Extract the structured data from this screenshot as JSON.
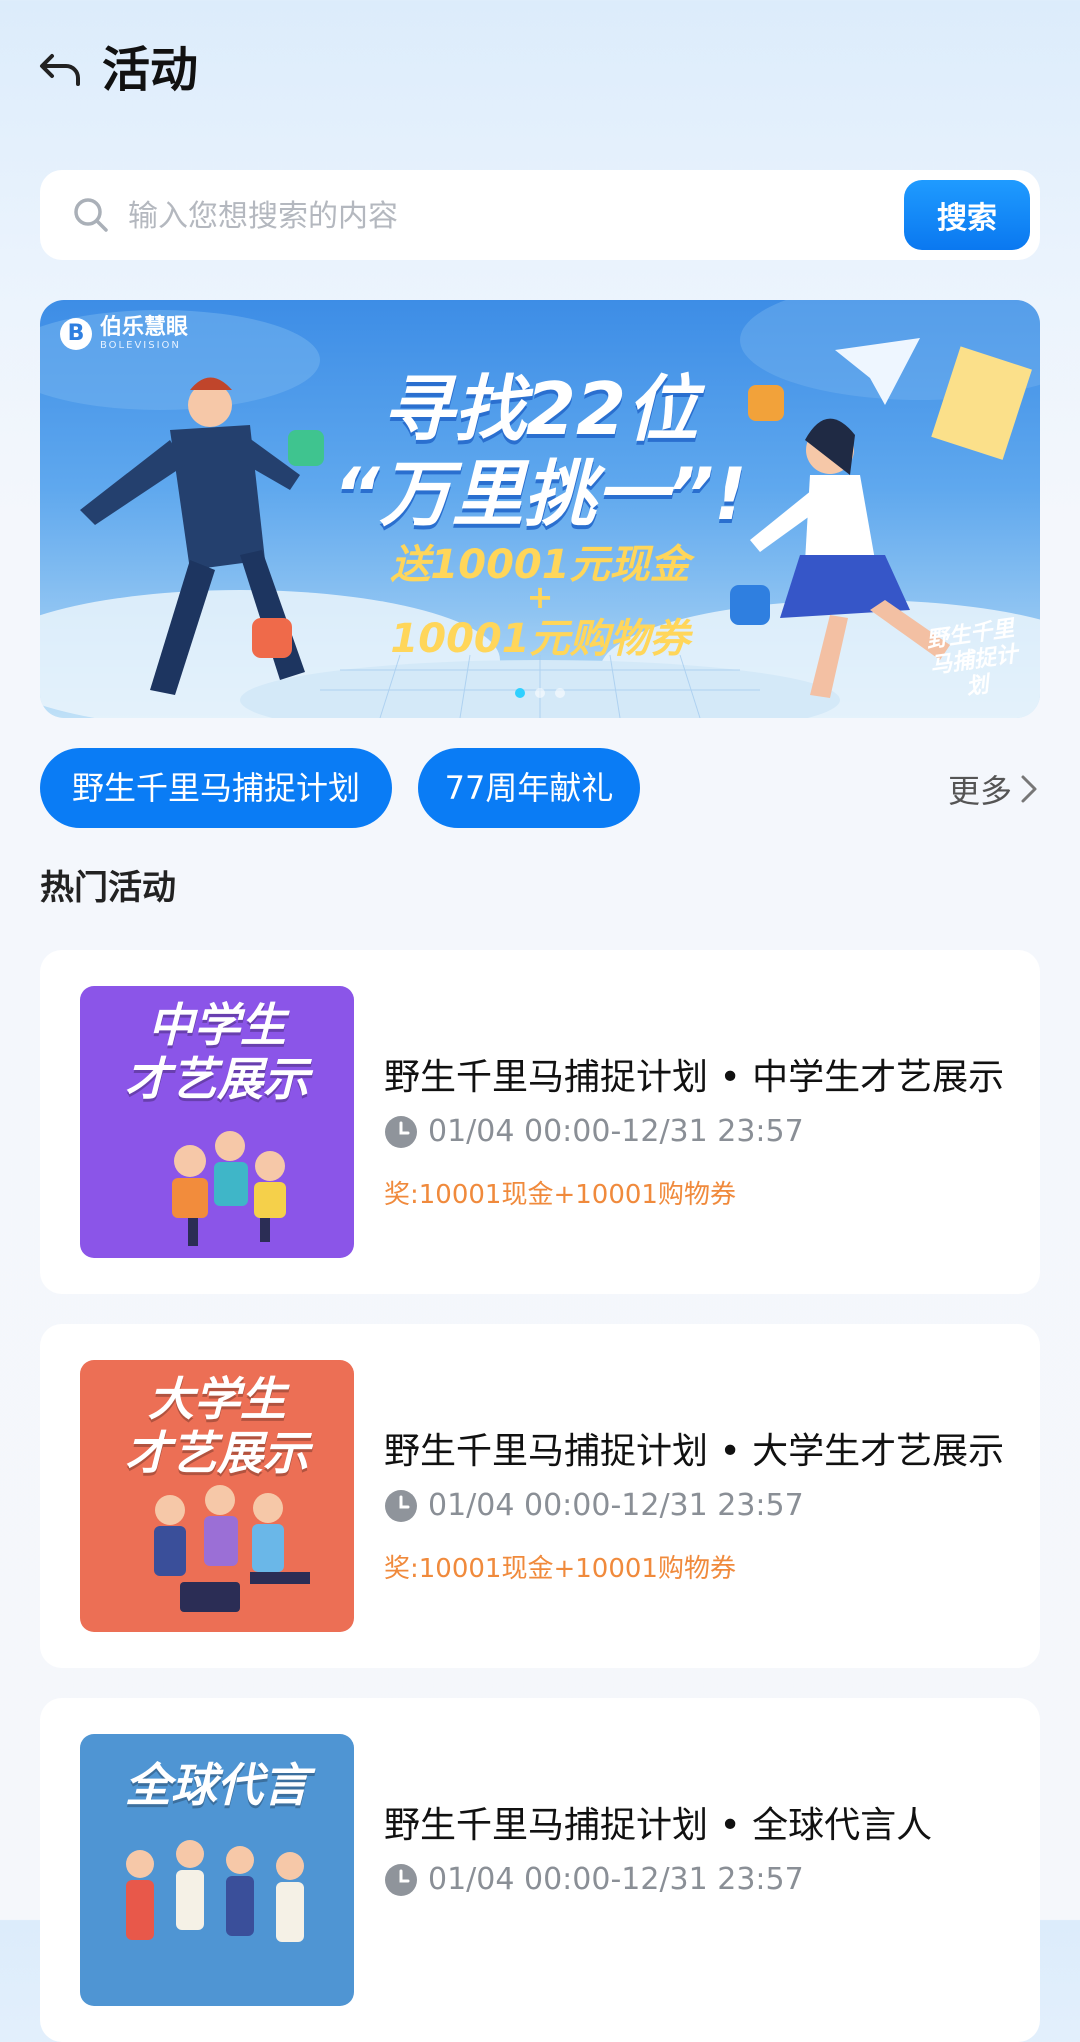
{
  "header": {
    "title": "活动"
  },
  "search": {
    "placeholder": "输入您想搜索的内容",
    "button_label": "搜索"
  },
  "banner": {
    "logo_text": "伯乐慧眼",
    "logo_sub": "BOLEVISION",
    "headline_1": "寻找22位",
    "headline_2": "“万里挑一”!",
    "prize_line_1": "送10001元现金",
    "prize_plus": "+",
    "prize_line_2": "10001元购物券",
    "stamp": "野生千里马捕捉计划",
    "dots": 3,
    "active_dot": 0
  },
  "tags": [
    {
      "label": "野生千里马捕捉计划"
    },
    {
      "label": "77周年献礼"
    }
  ],
  "more_label": "更多",
  "section_title": "热门活动",
  "activities": [
    {
      "thumb_title": "中学生\n才艺展示",
      "thumb_color": "#8b55e8",
      "title": "野生千里马捕捉计划 • 中学生才艺展示",
      "time": "01/04 00:00-12/31 23:57",
      "prize": "奖:10001现金+10001购物券"
    },
    {
      "thumb_title": "大学生\n才艺展示",
      "thumb_color": "#ec6f55",
      "title": "野生千里马捕捉计划 • 大学生才艺展示",
      "time": "01/04 00:00-12/31 23:57",
      "prize": "奖:10001现金+10001购物券"
    },
    {
      "thumb_title": "全球代言",
      "thumb_color": "#4f95d3",
      "title": "野生千里马捕捉计划 • 全球代言人",
      "time": "01/04 00:00-12/31 23:57",
      "prize": ""
    }
  ],
  "colors": {
    "primary": "#0a7cf5",
    "prize": "#f08a3c",
    "muted": "#8a8f96"
  }
}
